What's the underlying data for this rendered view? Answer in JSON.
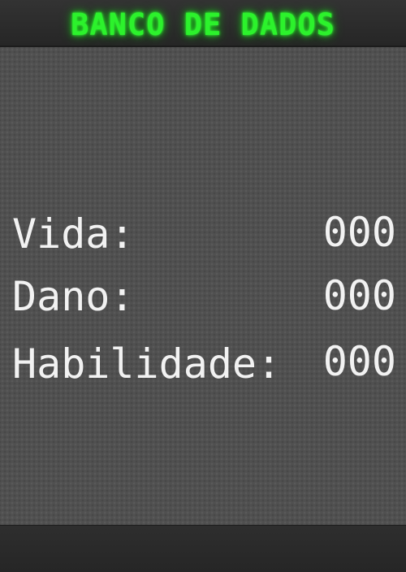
{
  "header": {
    "title": "BANCO DE DADOS"
  },
  "stats": [
    {
      "label": "Vida:",
      "value": "000"
    },
    {
      "label": "Dano:",
      "value": "000"
    },
    {
      "label": "Habilidade:",
      "value": "000"
    }
  ],
  "colors": {
    "title_glow": "#2cf22c",
    "panel_background": "#505050",
    "bar_background": "#2a2a2a",
    "text": "#f2f2f2"
  }
}
